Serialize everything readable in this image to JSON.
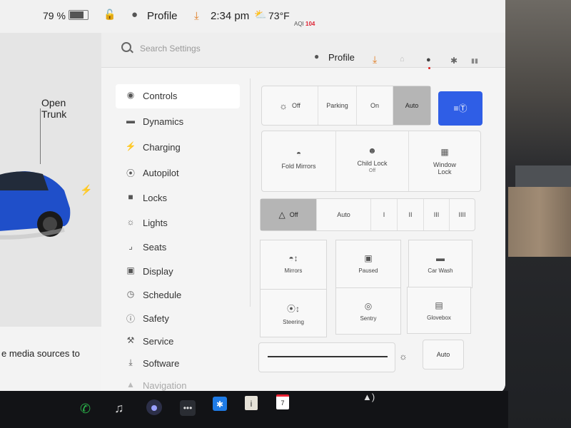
{
  "status": {
    "battery": "79 %",
    "profile": "Profile",
    "time": "2:34 pm",
    "temp": "73°F",
    "aqi_label": "AQI",
    "aqi_value": "104"
  },
  "car": {
    "trunk_line1": "Open",
    "trunk_line2": "Trunk",
    "card_text": "e media sources to"
  },
  "settings_header": {
    "search_placeholder": "Search Settings",
    "profile": "Profile"
  },
  "nav": {
    "items": [
      {
        "label": "Controls",
        "icon": "toggle-icon"
      },
      {
        "label": "Dynamics",
        "icon": "car-icon"
      },
      {
        "label": "Charging",
        "icon": "bolt-icon"
      },
      {
        "label": "Autopilot",
        "icon": "steering-wheel-icon"
      },
      {
        "label": "Locks",
        "icon": "lock-icon"
      },
      {
        "label": "Lights",
        "icon": "lightbulb-icon"
      },
      {
        "label": "Seats",
        "icon": "seat-icon"
      },
      {
        "label": "Display",
        "icon": "display-icon"
      },
      {
        "label": "Schedule",
        "icon": "alarm-clock-icon"
      },
      {
        "label": "Safety",
        "icon": "alert-icon"
      },
      {
        "label": "Service",
        "icon": "wrench-icon"
      },
      {
        "label": "Software",
        "icon": "download-icon"
      },
      {
        "label": "Navigation",
        "icon": "navigation-arrow-icon"
      }
    ],
    "active": "Controls"
  },
  "lights_row": {
    "off": "Off",
    "parking": "Parking",
    "on": "On",
    "auto": "Auto",
    "selected": "Auto",
    "auto_high_beam_icon": "auto-high-beam-icon"
  },
  "locks_row": {
    "fold_mirrors": "Fold Mirrors",
    "child_lock": "Child Lock",
    "child_lock_state": "Off",
    "window_lock_line1": "Window",
    "window_lock_line2": "Lock"
  },
  "wipers_row": {
    "off": "Off",
    "auto": "Auto",
    "speeds": [
      "I",
      "II",
      "III",
      "IIII"
    ],
    "selected": "Off"
  },
  "grid": {
    "mirrors": "Mirrors",
    "paused": "Paused",
    "car_wash": "Car Wash",
    "steering": "Steering",
    "sentry": "Sentry",
    "glovebox": "Glovebox"
  },
  "brightness": {
    "auto": "Auto"
  },
  "colors": {
    "accent_blue": "#2f5ee6",
    "download_orange": "#e07b20",
    "phone_green": "#2bb34a",
    "bluetooth_blue": "#1e7be6",
    "aqi_red": "#d22233"
  }
}
